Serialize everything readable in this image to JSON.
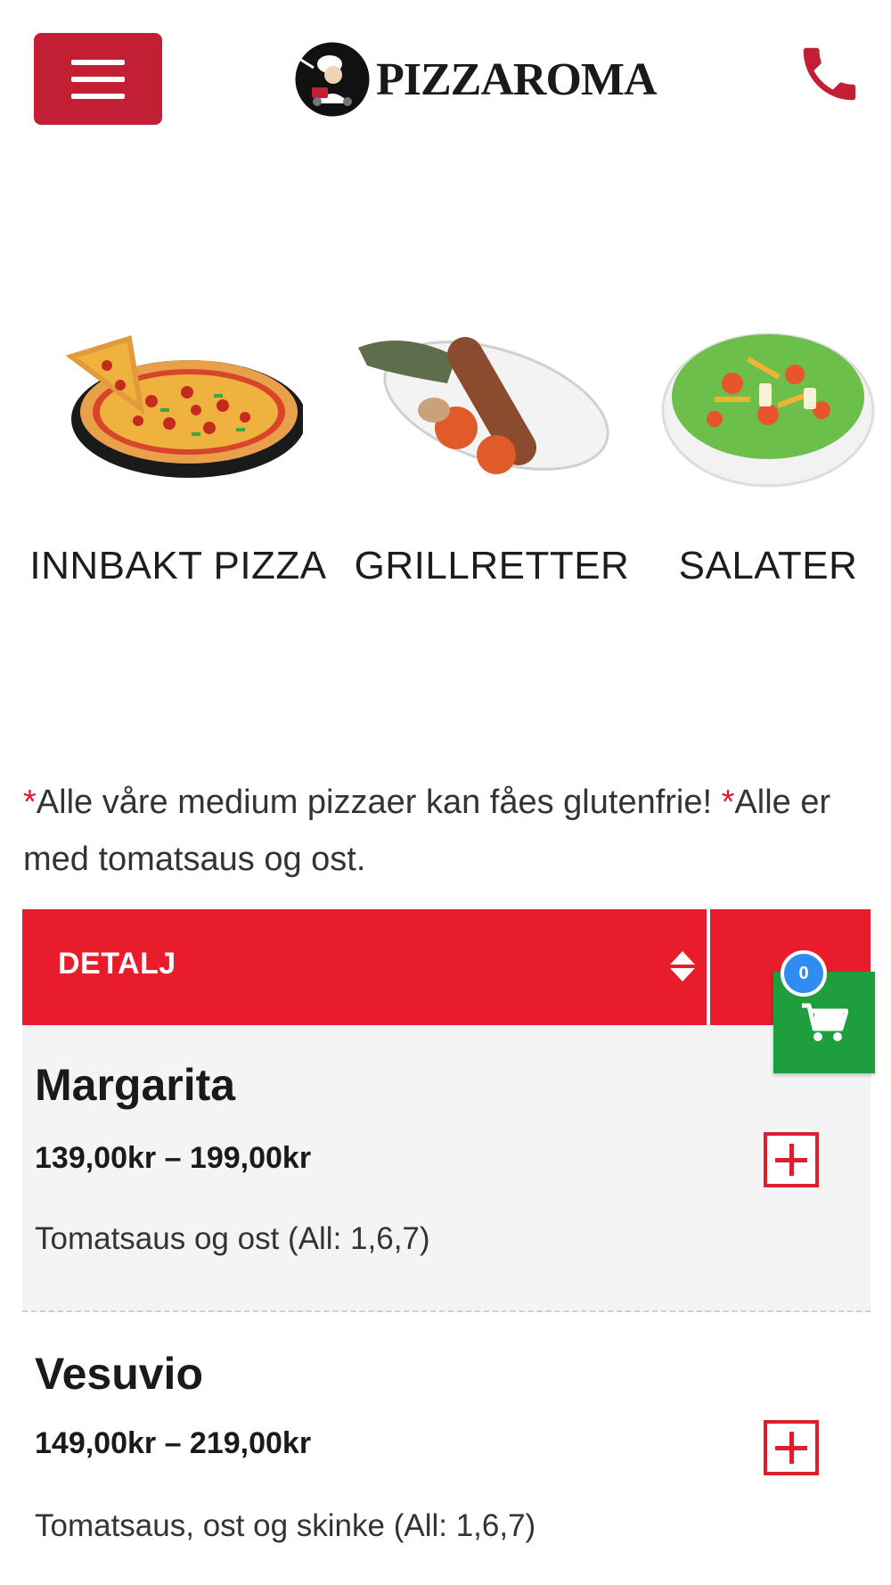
{
  "header": {
    "brand": "PIZZAROMA",
    "menu_icon": "hamburger-menu-icon",
    "phone_icon": "phone-icon",
    "accent_color": "#c21f35"
  },
  "categories": [
    {
      "label": "INNBAKT PIZZA",
      "image": "pizza-image"
    },
    {
      "label": "GRILLRETTER",
      "image": "grill-dish-image"
    },
    {
      "label": "SALATER",
      "image": "salad-image"
    }
  ],
  "notice": {
    "star": "*",
    "part1": "Alle våre medium pizzaer kan fåes glutenfrie!",
    "part2": "Alle er med tomatsaus og ost."
  },
  "table": {
    "header_label": "DETALJ",
    "sort_icon": "sort-icon",
    "header_color": "#e81c2b"
  },
  "cart": {
    "count": "0",
    "icon": "shopping-cart-icon",
    "color": "#1e9e3c",
    "badge_color": "#2f8cf0"
  },
  "products": [
    {
      "name": "Margarita",
      "price": "139,00kr – 199,00kr",
      "description": "Tomatsaus og ost (All: 1,6,7)"
    },
    {
      "name": "Vesuvio",
      "price": "149,00kr – 219,00kr",
      "description": "Tomatsaus, ost og skinke (All: 1,6,7)"
    }
  ]
}
